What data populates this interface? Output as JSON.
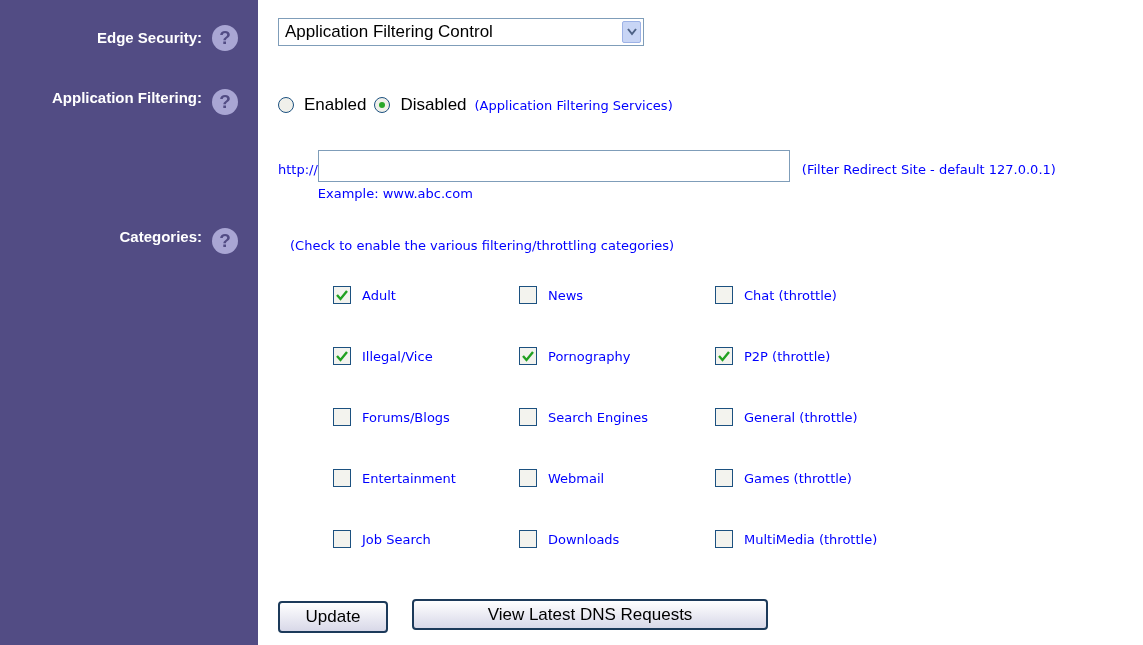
{
  "edge_security": {
    "label": "Edge Security:",
    "help": "?",
    "value": "Application Filtering Control"
  },
  "application_filtering": {
    "label": "Application Filtering:",
    "help": "?",
    "options": [
      {
        "label": "Enabled",
        "selected": false
      },
      {
        "label": "Disabled",
        "selected": true
      }
    ],
    "link": "(Application Filtering Services)"
  },
  "redirect": {
    "prefix": "http://",
    "hint": "(Filter Redirect Site - default 127.0.0.1)",
    "example": "Example: www.abc.com"
  },
  "categories": {
    "label": "Categories:",
    "help": "?",
    "note": "(Check to enable the various filtering/throttling categories)",
    "items": [
      {
        "label": "Adult",
        "checked": true
      },
      {
        "label": "News",
        "checked": false
      },
      {
        "label": "Chat (throttle)",
        "checked": false
      },
      {
        "label": "Illegal/Vice",
        "checked": true
      },
      {
        "label": "Pornography",
        "checked": true
      },
      {
        "label": "P2P (throttle)",
        "checked": true
      },
      {
        "label": "Forums/Blogs",
        "checked": false
      },
      {
        "label": "Search Engines",
        "checked": false
      },
      {
        "label": "General (throttle)",
        "checked": false
      },
      {
        "label": "Entertainment",
        "checked": false
      },
      {
        "label": "Webmail",
        "checked": false
      },
      {
        "label": "Games (throttle)",
        "checked": false
      },
      {
        "label": "Job Search",
        "checked": false
      },
      {
        "label": "Downloads",
        "checked": false
      },
      {
        "label": "MultiMedia (throttle)",
        "checked": false
      }
    ]
  },
  "buttons": [
    "Update",
    "View Latest DNS Requests"
  ]
}
